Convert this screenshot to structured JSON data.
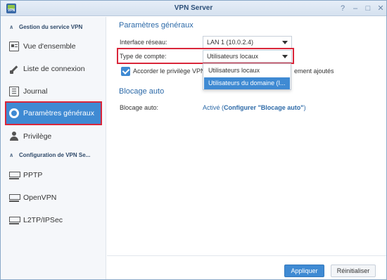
{
  "window": {
    "title": "VPN Server",
    "controls": [
      "?",
      "–",
      "□",
      "✕"
    ],
    "app_icon_text": "VPN"
  },
  "sidebar": {
    "section1": "Gestion du service VPN",
    "items1": [
      {
        "label": "Vue d'ensemble",
        "icon": "overview-icon"
      },
      {
        "label": "Liste de connexion",
        "icon": "plug-icon"
      },
      {
        "label": "Journal",
        "icon": "journal-icon"
      },
      {
        "label": "Paramètres généraux",
        "icon": "gear-icon",
        "active": true
      },
      {
        "label": "Privilège",
        "icon": "user-icon"
      }
    ],
    "section2": "Configuration de VPN Se...",
    "items2": [
      {
        "label": "PPTP",
        "icon": "network-icon"
      },
      {
        "label": "OpenVPN",
        "icon": "network-icon"
      },
      {
        "label": "L2TP/IPSec",
        "icon": "network-icon"
      }
    ]
  },
  "main": {
    "section_general": "Paramètres généraux",
    "interface_label": "Interface réseau:",
    "interface_value": "LAN 1 (10.0.2.4)",
    "account_label": "Type de compte:",
    "account_value": "Utilisateurs locaux",
    "checkbox_text": "Accorder le privilège VPN",
    "checkbox_text_tail": "ement ajoutés",
    "dropdown_options": [
      "Utilisateurs locaux",
      "Utilisateurs du domaine (I..."
    ],
    "dropdown_selected_index": 1,
    "section_block": "Blocage auto",
    "block_label": "Blocage auto:",
    "block_status": "Activé (",
    "block_link": "Configurer \"Blocage auto\"",
    "block_close": ")"
  },
  "footer": {
    "apply": "Appliquer",
    "reset": "Réinitialiser"
  },
  "colors": {
    "accent": "#3f8ad3",
    "highlight_border": "#d9263a",
    "title_text": "#2c4f78",
    "section_text": "#2d6aa8"
  }
}
